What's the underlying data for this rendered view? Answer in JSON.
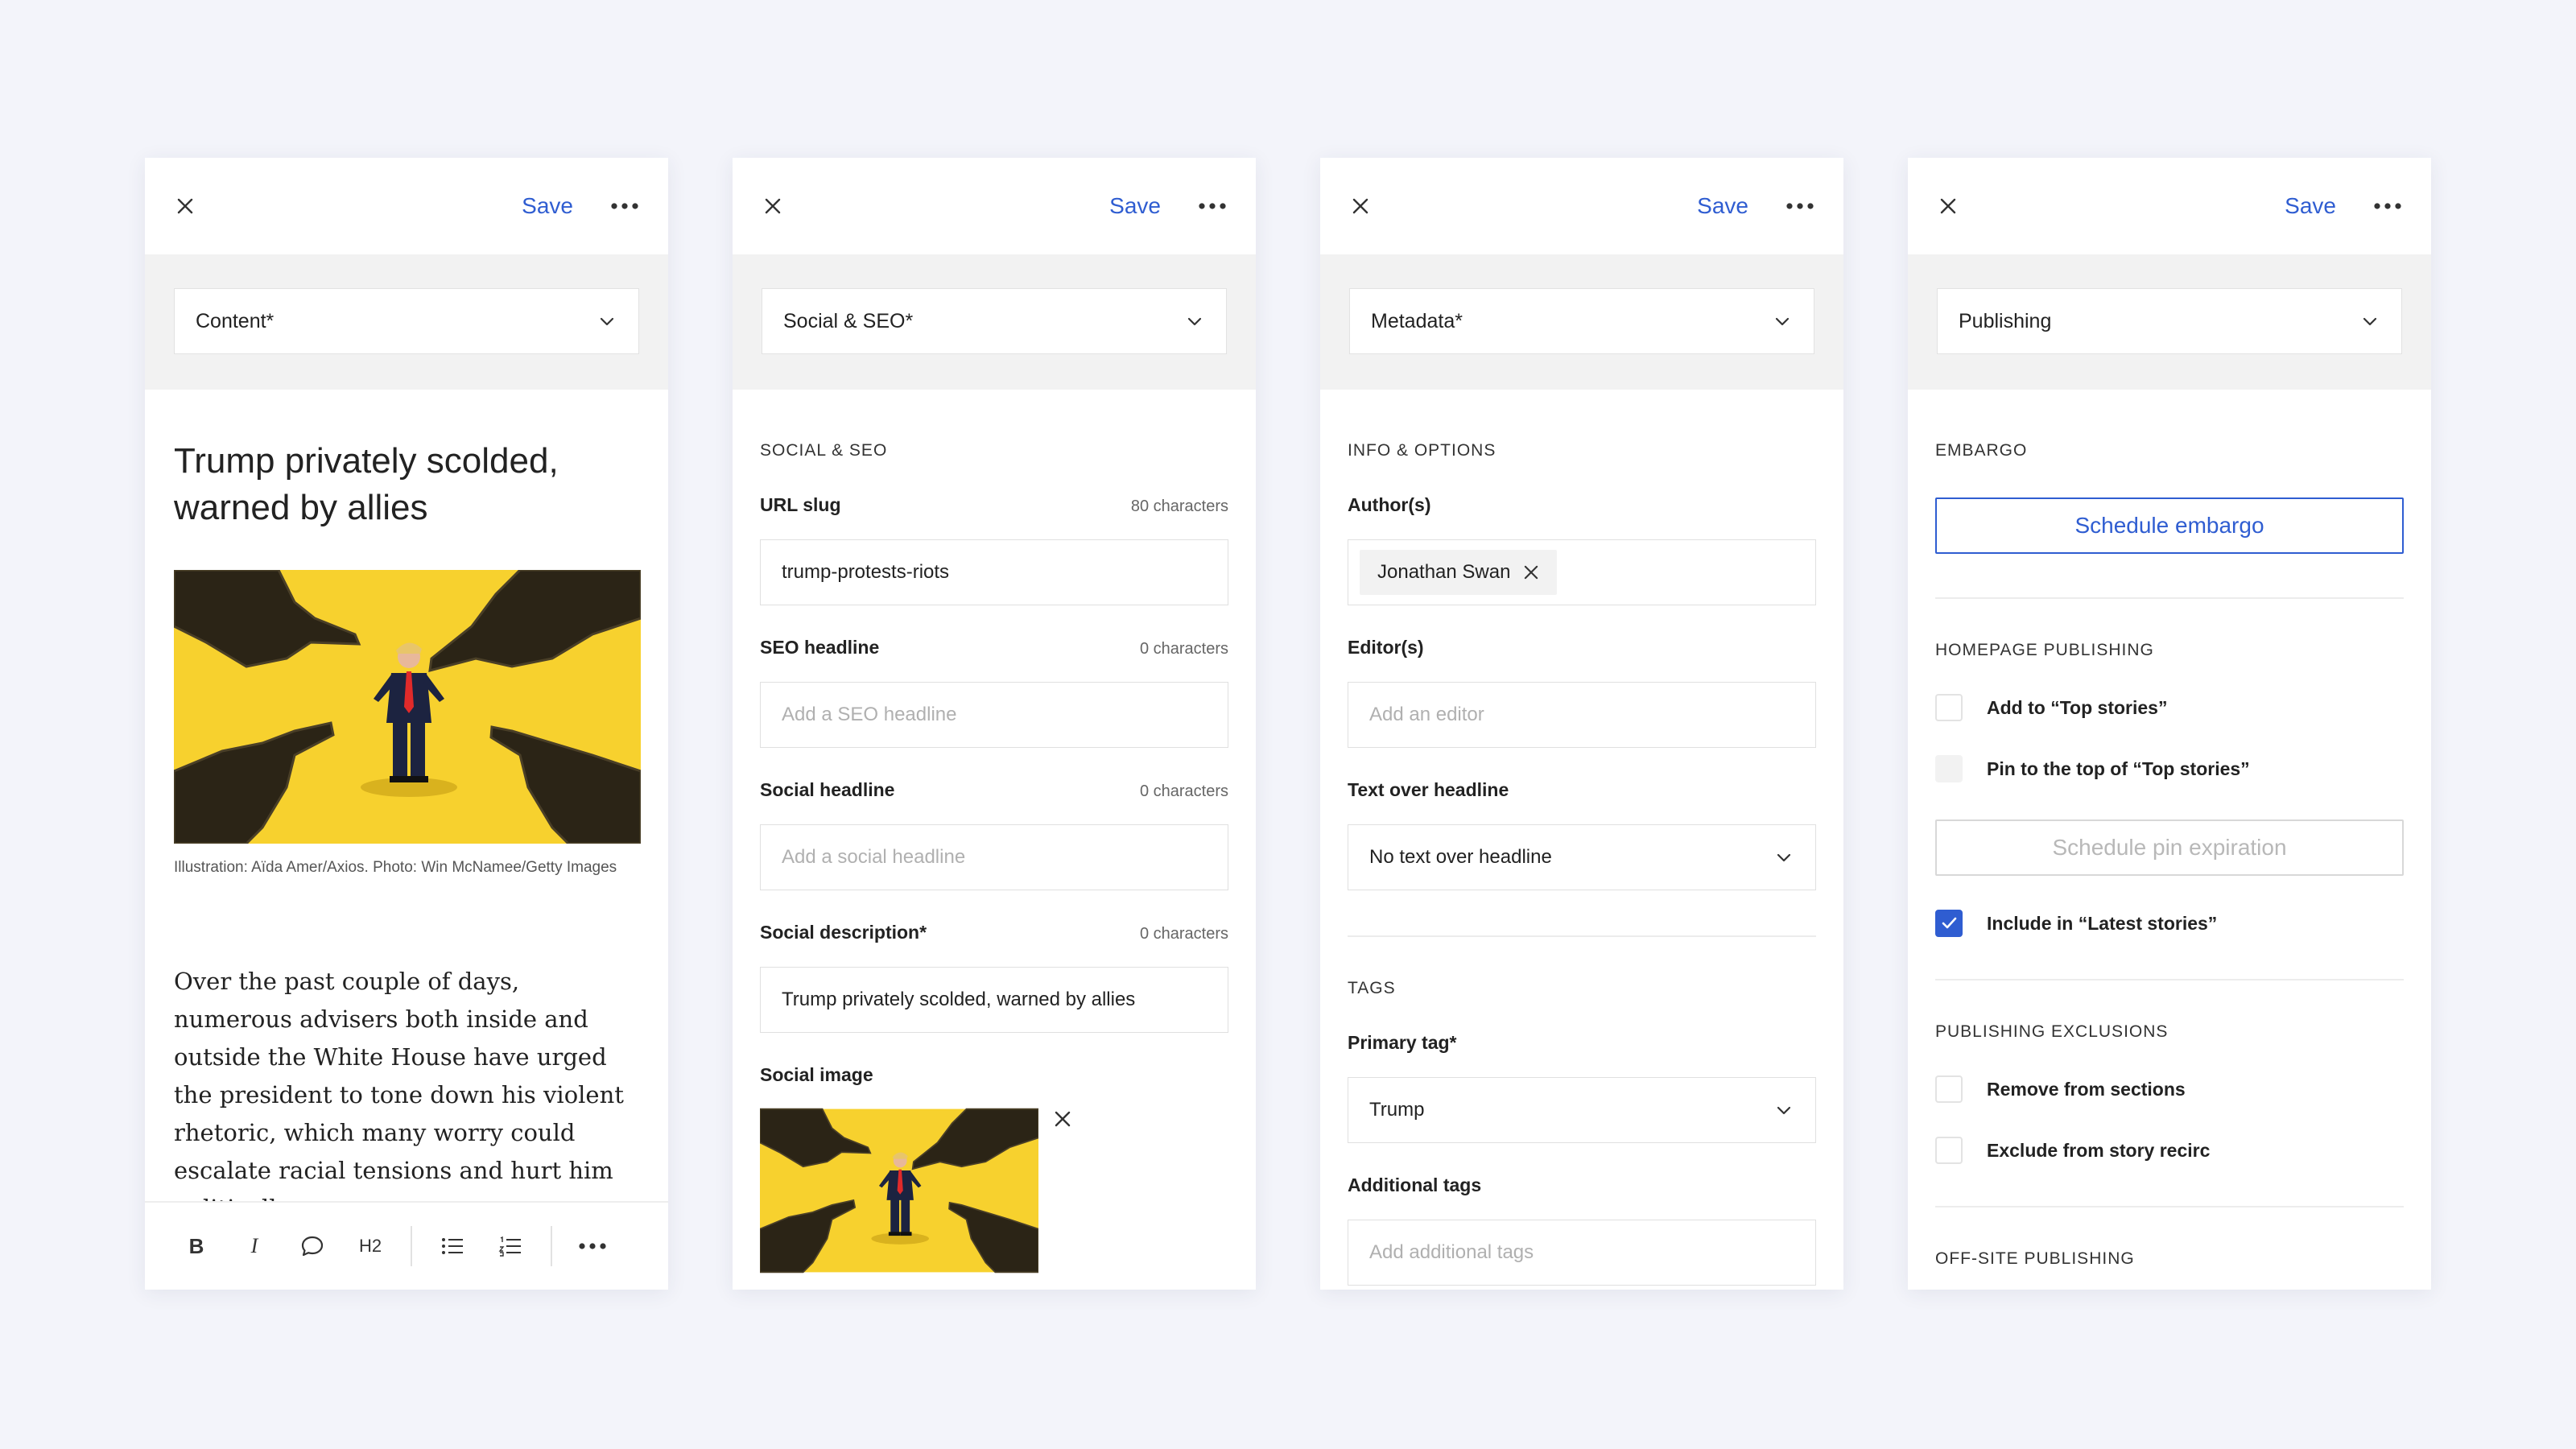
{
  "common": {
    "save_label": "Save"
  },
  "panels": {
    "content": {
      "section_select": "Content*",
      "title": "Trump privately scolded, warned by allies",
      "caption": "Illustration: Aïda Amer/Axios. Photo: Win McNamee/Getty Images",
      "body": "Over the past couple of days, numerous advisers both inside and outside the White House have urged the president to tone down his violent rhetoric, which many worry could escalate racial tensions and hurt him politically.",
      "toolbar": {
        "bold": "B",
        "italic": "I",
        "heading": "H2"
      }
    },
    "social": {
      "section_select": "Social & SEO*",
      "section_heading": "SOCIAL & SEO",
      "url_slug": {
        "label": "URL slug",
        "count": "80 characters",
        "value": "trump-protests-riots"
      },
      "seo_headline": {
        "label": "SEO headline",
        "count": "0 characters",
        "placeholder": "Add a SEO headline"
      },
      "social_headline": {
        "label": "Social headline",
        "count": "0 characters",
        "placeholder": "Add a social headline"
      },
      "social_description": {
        "label": "Social description*",
        "count": "0 characters",
        "value": "Trump privately scolded, warned by allies"
      },
      "social_image": {
        "label": "Social image"
      }
    },
    "metadata": {
      "section_select": "Metadata*",
      "info_heading": "INFO & OPTIONS",
      "authors": {
        "label": "Author(s)",
        "chips": [
          "Jonathan Swan"
        ]
      },
      "editors": {
        "label": "Editor(s)",
        "placeholder": "Add an editor"
      },
      "text_over": {
        "label": "Text over headline",
        "value": "No text over headline"
      },
      "tags_heading": "TAGS",
      "primary_tag": {
        "label": "Primary tag*",
        "value": "Trump"
      },
      "additional_tags": {
        "label": "Additional tags",
        "placeholder": "Add additional tags"
      }
    },
    "publishing": {
      "section_select": "Publishing",
      "embargo_heading": "EMBARGO",
      "schedule_embargo": "Schedule embargo",
      "homepage_heading": "HOMEPAGE PUBLISHING",
      "add_top_stories": {
        "label": "Add to “Top stories”",
        "checked": false
      },
      "pin_top_stories": {
        "label": "Pin to the top of “Top stories”",
        "checked": false,
        "disabled": true
      },
      "schedule_pin": "Schedule pin expiration",
      "include_latest": {
        "label": "Include in “Latest stories”",
        "checked": true
      },
      "exclusions_heading": "PUBLISHING EXCLUSIONS",
      "remove_sections": {
        "label": "Remove from sections",
        "checked": false
      },
      "exclude_recirc": {
        "label": "Exclude from story recirc",
        "checked": false
      },
      "offsite_heading": "OFF-SITE PUBLISHING"
    }
  },
  "colors": {
    "accent": "#2f5dd1",
    "illustration_yellow": "#f7d12e",
    "background": "#f3f4fa"
  }
}
